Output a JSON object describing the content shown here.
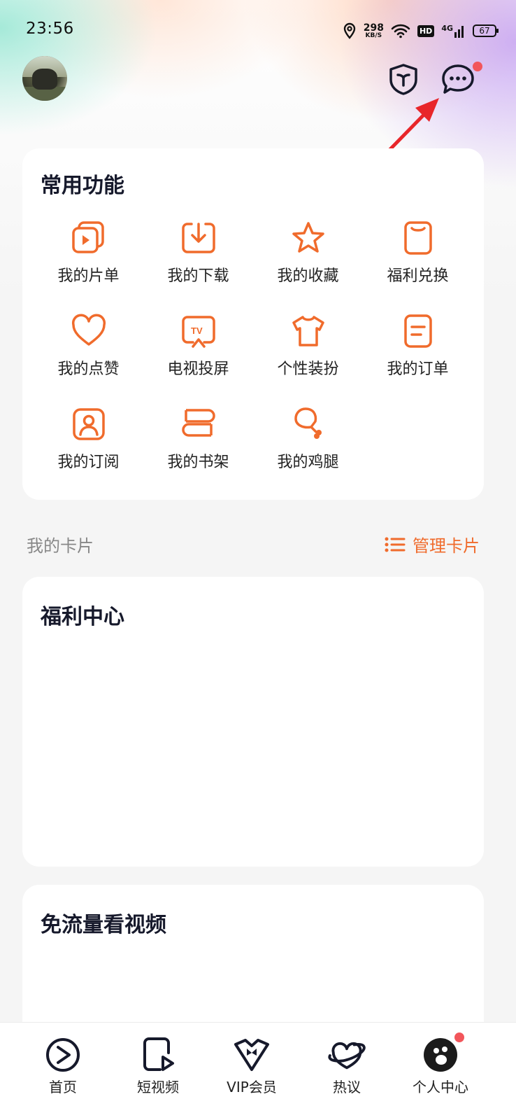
{
  "status_bar": {
    "time": "23:56",
    "speed_value": "298",
    "speed_unit": "KB/S",
    "hd": "HD",
    "network": "4G",
    "battery": "67"
  },
  "header": {
    "avatar_icon": "user-avatar",
    "shield_icon": "shield-icon",
    "message_icon": "message-icon",
    "message_badge": true
  },
  "common_functions": {
    "title": "常用功能",
    "items": [
      {
        "label": "我的片单",
        "icon": "playlist-icon"
      },
      {
        "label": "我的下载",
        "icon": "download-icon"
      },
      {
        "label": "我的收藏",
        "icon": "star-icon"
      },
      {
        "label": "福利兑换",
        "icon": "redeem-icon"
      },
      {
        "label": "我的点赞",
        "icon": "heart-icon"
      },
      {
        "label": "电视投屏",
        "icon": "tv-cast-icon"
      },
      {
        "label": "个性装扮",
        "icon": "tshirt-icon"
      },
      {
        "label": "我的订单",
        "icon": "order-icon"
      },
      {
        "label": "我的订阅",
        "icon": "subscribe-icon"
      },
      {
        "label": "我的书架",
        "icon": "bookshelf-icon"
      },
      {
        "label": "我的鸡腿",
        "icon": "drumstick-icon"
      }
    ]
  },
  "my_cards": {
    "label": "我的卡片",
    "manage_label": "管理卡片"
  },
  "welfare_center": {
    "title": "福利中心"
  },
  "free_data_video": {
    "title": "免流量看视频"
  },
  "bottom_nav": {
    "items": [
      {
        "label": "首页",
        "icon": "home-play-icon"
      },
      {
        "label": "短视频",
        "icon": "short-video-icon"
      },
      {
        "label": "VIP会员",
        "icon": "vip-icon"
      },
      {
        "label": "热议",
        "icon": "discussion-icon"
      },
      {
        "label": "个人中心",
        "icon": "profile-avatar-icon"
      }
    ]
  },
  "colors": {
    "accent": "#f06b2c",
    "badge": "#f2565b",
    "title": "#16192b"
  }
}
